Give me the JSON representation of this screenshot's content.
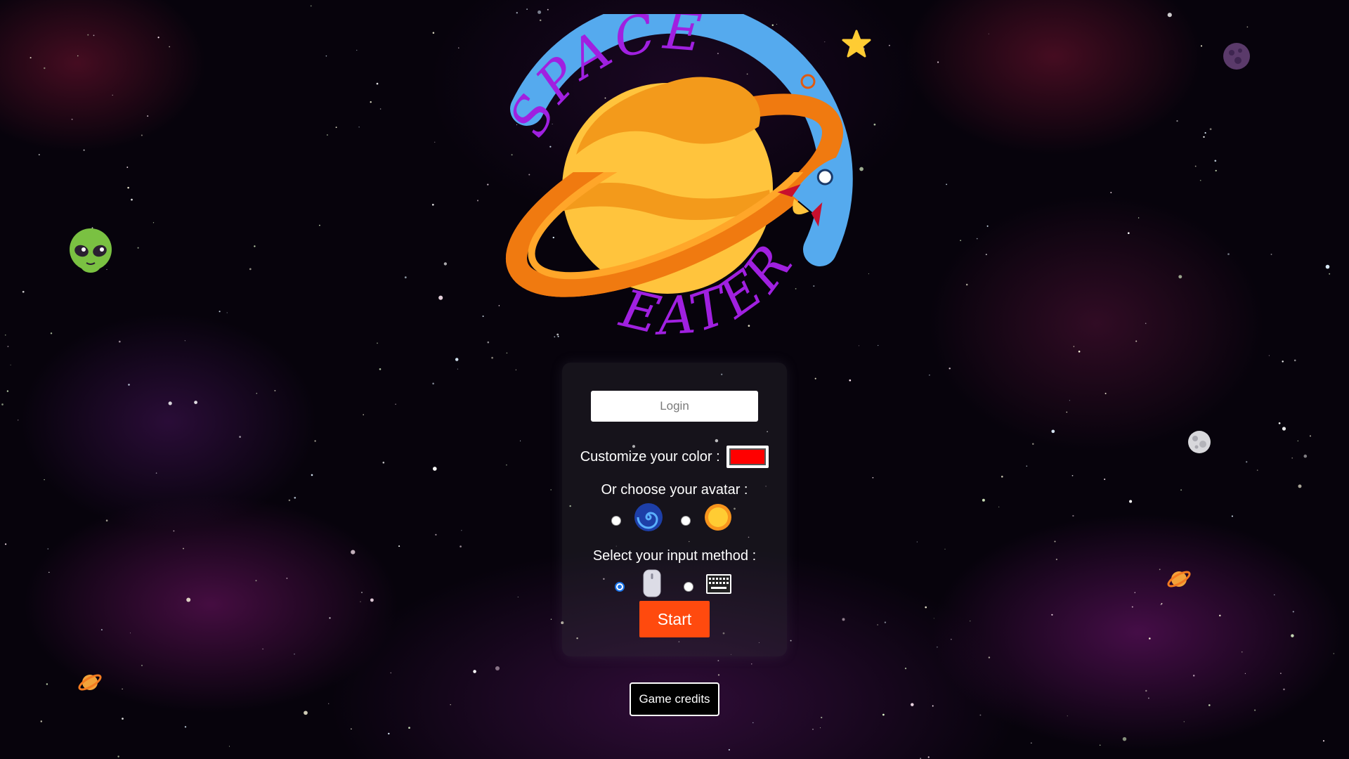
{
  "logo": {
    "word1": "SPACE",
    "word2": "EATER"
  },
  "form": {
    "login_placeholder": "Login",
    "color_label": "Customize your color :",
    "color_value": "#ff0000",
    "avatar_label": "Or choose your avatar :",
    "avatar_options": [
      {
        "icon": "spiral-galaxy-icon",
        "selected": false
      },
      {
        "icon": "sun-icon",
        "selected": false
      }
    ],
    "input_label": "Select your input method :",
    "input_options": [
      {
        "icon": "computer-mouse-icon",
        "selected": true
      },
      {
        "icon": "keyboard-icon",
        "selected": false
      }
    ],
    "start_label": "Start"
  },
  "credits_label": "Game credits",
  "decorations": [
    "alien-icon",
    "star-icon",
    "moon-icon",
    "full-moon-icon",
    "ringed-planet-icon",
    "ringed-planet-icon"
  ],
  "colors": {
    "accent": "#ff4a0e",
    "logo_ring": "#55aaee",
    "logo_text": "#a020e0",
    "planet": "#ffc43d",
    "planet_ring": "#f07a10"
  }
}
